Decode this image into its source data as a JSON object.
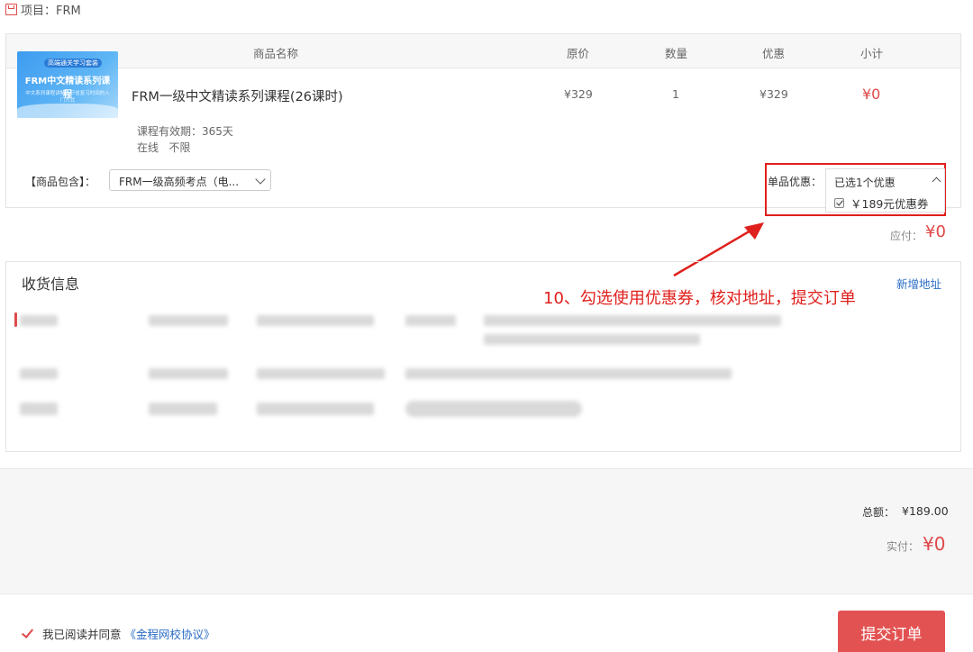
{
  "project": {
    "label": "项目：FRM"
  },
  "cart": {
    "columns": {
      "name": "商品名称",
      "price": "原价",
      "qty": "数量",
      "discount": "优惠",
      "subtotal": "小计"
    },
    "item": {
      "thumb_tag": "高端通关学习套装",
      "thumb_title": "FRM中文精读系列课程",
      "thumb_sub": "中文系列课程讲解，节省复习时间的入门方式",
      "name": "FRM一级中文精读系列课程(26课时)",
      "price": "¥329",
      "qty": "1",
      "discount": "¥329",
      "subtotal": "¥0",
      "validity": "课程有效期：365天",
      "mode": "在线   不限"
    },
    "includes_label": "【商品包含】：",
    "includes_value": "FRM一级高频考点（电...",
    "item_discount_label": "单品优惠：",
    "item_discount_selected": "已选1个优惠",
    "coupon_label": "￥189元优惠券",
    "payable_label": "应付：",
    "payable_value": "¥0"
  },
  "shipping": {
    "title": "收货信息",
    "add_address": "新增地址"
  },
  "annotation": "10、勾选使用优惠券，核对地址，提交订单",
  "summary": {
    "total_label": "总额：",
    "total_value": "¥189.00",
    "actual_label": "实付：",
    "actual_value": "¥0"
  },
  "footer": {
    "agree_text": "我已阅读并同意",
    "agree_link": "《金程网校协议》",
    "submit": "提交订单"
  },
  "colors": {
    "accent_red": "#e04848",
    "link_blue": "#2b6cc4",
    "annotation_red": "#e0201c"
  }
}
